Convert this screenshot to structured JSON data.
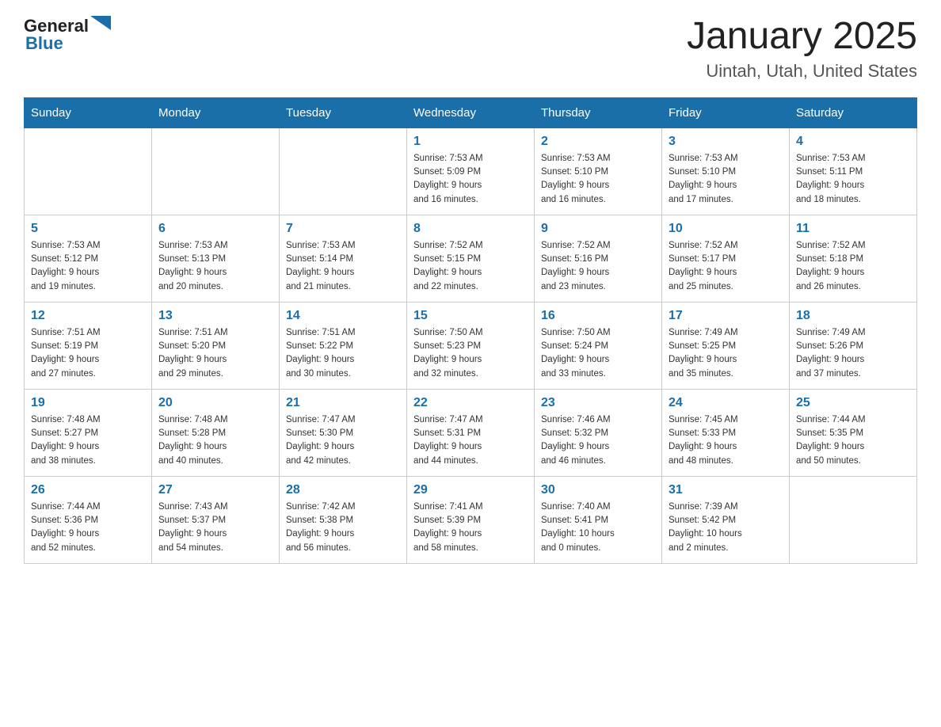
{
  "logo": {
    "general": "General",
    "blue": "Blue"
  },
  "header": {
    "title": "January 2025",
    "subtitle": "Uintah, Utah, United States"
  },
  "weekdays": [
    "Sunday",
    "Monday",
    "Tuesday",
    "Wednesday",
    "Thursday",
    "Friday",
    "Saturday"
  ],
  "weeks": [
    [
      {
        "day": "",
        "info": ""
      },
      {
        "day": "",
        "info": ""
      },
      {
        "day": "",
        "info": ""
      },
      {
        "day": "1",
        "info": "Sunrise: 7:53 AM\nSunset: 5:09 PM\nDaylight: 9 hours\nand 16 minutes."
      },
      {
        "day": "2",
        "info": "Sunrise: 7:53 AM\nSunset: 5:10 PM\nDaylight: 9 hours\nand 16 minutes."
      },
      {
        "day": "3",
        "info": "Sunrise: 7:53 AM\nSunset: 5:10 PM\nDaylight: 9 hours\nand 17 minutes."
      },
      {
        "day": "4",
        "info": "Sunrise: 7:53 AM\nSunset: 5:11 PM\nDaylight: 9 hours\nand 18 minutes."
      }
    ],
    [
      {
        "day": "5",
        "info": "Sunrise: 7:53 AM\nSunset: 5:12 PM\nDaylight: 9 hours\nand 19 minutes."
      },
      {
        "day": "6",
        "info": "Sunrise: 7:53 AM\nSunset: 5:13 PM\nDaylight: 9 hours\nand 20 minutes."
      },
      {
        "day": "7",
        "info": "Sunrise: 7:53 AM\nSunset: 5:14 PM\nDaylight: 9 hours\nand 21 minutes."
      },
      {
        "day": "8",
        "info": "Sunrise: 7:52 AM\nSunset: 5:15 PM\nDaylight: 9 hours\nand 22 minutes."
      },
      {
        "day": "9",
        "info": "Sunrise: 7:52 AM\nSunset: 5:16 PM\nDaylight: 9 hours\nand 23 minutes."
      },
      {
        "day": "10",
        "info": "Sunrise: 7:52 AM\nSunset: 5:17 PM\nDaylight: 9 hours\nand 25 minutes."
      },
      {
        "day": "11",
        "info": "Sunrise: 7:52 AM\nSunset: 5:18 PM\nDaylight: 9 hours\nand 26 minutes."
      }
    ],
    [
      {
        "day": "12",
        "info": "Sunrise: 7:51 AM\nSunset: 5:19 PM\nDaylight: 9 hours\nand 27 minutes."
      },
      {
        "day": "13",
        "info": "Sunrise: 7:51 AM\nSunset: 5:20 PM\nDaylight: 9 hours\nand 29 minutes."
      },
      {
        "day": "14",
        "info": "Sunrise: 7:51 AM\nSunset: 5:22 PM\nDaylight: 9 hours\nand 30 minutes."
      },
      {
        "day": "15",
        "info": "Sunrise: 7:50 AM\nSunset: 5:23 PM\nDaylight: 9 hours\nand 32 minutes."
      },
      {
        "day": "16",
        "info": "Sunrise: 7:50 AM\nSunset: 5:24 PM\nDaylight: 9 hours\nand 33 minutes."
      },
      {
        "day": "17",
        "info": "Sunrise: 7:49 AM\nSunset: 5:25 PM\nDaylight: 9 hours\nand 35 minutes."
      },
      {
        "day": "18",
        "info": "Sunrise: 7:49 AM\nSunset: 5:26 PM\nDaylight: 9 hours\nand 37 minutes."
      }
    ],
    [
      {
        "day": "19",
        "info": "Sunrise: 7:48 AM\nSunset: 5:27 PM\nDaylight: 9 hours\nand 38 minutes."
      },
      {
        "day": "20",
        "info": "Sunrise: 7:48 AM\nSunset: 5:28 PM\nDaylight: 9 hours\nand 40 minutes."
      },
      {
        "day": "21",
        "info": "Sunrise: 7:47 AM\nSunset: 5:30 PM\nDaylight: 9 hours\nand 42 minutes."
      },
      {
        "day": "22",
        "info": "Sunrise: 7:47 AM\nSunset: 5:31 PM\nDaylight: 9 hours\nand 44 minutes."
      },
      {
        "day": "23",
        "info": "Sunrise: 7:46 AM\nSunset: 5:32 PM\nDaylight: 9 hours\nand 46 minutes."
      },
      {
        "day": "24",
        "info": "Sunrise: 7:45 AM\nSunset: 5:33 PM\nDaylight: 9 hours\nand 48 minutes."
      },
      {
        "day": "25",
        "info": "Sunrise: 7:44 AM\nSunset: 5:35 PM\nDaylight: 9 hours\nand 50 minutes."
      }
    ],
    [
      {
        "day": "26",
        "info": "Sunrise: 7:44 AM\nSunset: 5:36 PM\nDaylight: 9 hours\nand 52 minutes."
      },
      {
        "day": "27",
        "info": "Sunrise: 7:43 AM\nSunset: 5:37 PM\nDaylight: 9 hours\nand 54 minutes."
      },
      {
        "day": "28",
        "info": "Sunrise: 7:42 AM\nSunset: 5:38 PM\nDaylight: 9 hours\nand 56 minutes."
      },
      {
        "day": "29",
        "info": "Sunrise: 7:41 AM\nSunset: 5:39 PM\nDaylight: 9 hours\nand 58 minutes."
      },
      {
        "day": "30",
        "info": "Sunrise: 7:40 AM\nSunset: 5:41 PM\nDaylight: 10 hours\nand 0 minutes."
      },
      {
        "day": "31",
        "info": "Sunrise: 7:39 AM\nSunset: 5:42 PM\nDaylight: 10 hours\nand 2 minutes."
      },
      {
        "day": "",
        "info": ""
      }
    ]
  ]
}
